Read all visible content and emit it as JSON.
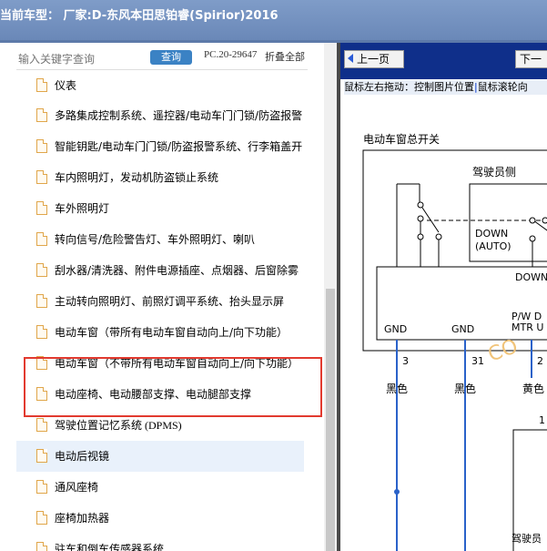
{
  "title_bar": {
    "text": "当前车型： 厂家:D-东风本田思铂睿(Spirior)2016"
  },
  "search": {
    "placeholder": "输入关键字查询",
    "button_label": "查询",
    "pc_code": "PC.20-29647",
    "collapse_label": "折叠全部"
  },
  "tree": {
    "items": [
      {
        "label": "仪表"
      },
      {
        "label": "多路集成控制系统、遥控器/电动车门门锁/防盗报警"
      },
      {
        "label": "智能钥匙/电动车门门锁/防盗报警系统、行李箱盖开"
      },
      {
        "label": "车内照明灯，发动机防盗锁止系统"
      },
      {
        "label": "车外照明灯"
      },
      {
        "label": "转向信号/危险警告灯、车外照明灯、喇叭"
      },
      {
        "label": "刮水器/清洗器、附件电源插座、点烟器、后窗除雾"
      },
      {
        "label": "主动转向照明灯、前照灯调平系统、抬头显示屏"
      },
      {
        "label": "电动车窗（带所有电动车窗自动向上/向下功能）"
      },
      {
        "label": "电动车窗（不带所有电动车窗自动向上/向下功能）"
      },
      {
        "label": "电动座椅、电动腰部支撑、电动腿部支撑"
      },
      {
        "label": "驾驶位置记忆系统 (DPMS)"
      },
      {
        "label": "电动后视镜"
      },
      {
        "label": "通风座椅"
      },
      {
        "label": "座椅加热器"
      },
      {
        "label": "驻车和倒车传感器系统"
      }
    ]
  },
  "viewer": {
    "prev_label": "上一页",
    "next_label": "下一",
    "hint_drag": "鼠标左右拖动：控制图片位置",
    "hint_sep": "|",
    "hint_wheel": "鼠标滚轮向",
    "diagram": {
      "title": "电动车窗总开关",
      "driver_side": "驾驶员侧",
      "down": "DOWN",
      "auto": "(AUTO)",
      "down2": "DOWN",
      "gnd1": "GND",
      "gnd2": "GND",
      "pw_label1": "P/W D",
      "pw_label2": "MTR U",
      "pin1": "3",
      "pin2": "31",
      "pin3": "2",
      "pin4": "1",
      "wire1": "黑色",
      "wire2": "黑色",
      "wire3": "黄色",
      "bottom_label": "驾驶员",
      "watermark": "CO"
    }
  },
  "colors": {
    "accent": "#3b82c4",
    "highlight": "#e23a2f",
    "nav": "#0f2f8a",
    "wire": "#2a62c9"
  }
}
